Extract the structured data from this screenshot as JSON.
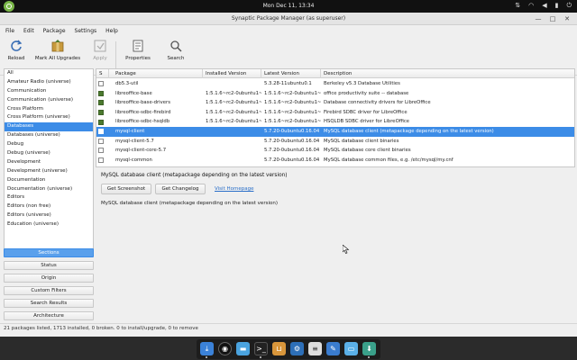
{
  "topbar": {
    "clock": "Mon Dec 11, 13:34",
    "icons": [
      "ubuntu-logo-icon",
      "network-icon",
      "wifi-icon",
      "volume-icon",
      "battery-icon",
      "power-icon"
    ]
  },
  "window": {
    "title": "Synaptic Package Manager  (as superuser)",
    "controls": [
      "minimize",
      "maximize",
      "close"
    ]
  },
  "menubar": [
    "File",
    "Edit",
    "Package",
    "Settings",
    "Help"
  ],
  "toolbar": {
    "reload": "Reload",
    "mark_all": "Mark All Upgrades",
    "apply": "Apply",
    "properties": "Properties",
    "search": "Search"
  },
  "sidebar": {
    "items": [
      "All",
      "Amateur Radio (universe)",
      "Communication",
      "Communication (universe)",
      "Cross Platform",
      "Cross Platform (universe)",
      "Databases",
      "Databases (universe)",
      "Debug",
      "Debug (universe)",
      "Development",
      "Development (universe)",
      "Documentation",
      "Documentation (universe)",
      "Editors",
      "Editors (non free)",
      "Editors (universe)",
      "Education (universe)"
    ],
    "selected_index": 6,
    "buttons": [
      "Sections",
      "Status",
      "Origin",
      "Custom Filters",
      "Search Results",
      "Architecture"
    ]
  },
  "table": {
    "headers": {
      "s": "S",
      "package": "Package",
      "installed": "Installed Version",
      "latest": "Latest Version",
      "description": "Description"
    },
    "rows": [
      {
        "installed_flag": false,
        "package": "db5.3-util",
        "installed": "",
        "latest": "5.3.28-11ubuntu0.1",
        "description": "Berkeley v5.3 Database Utilities"
      },
      {
        "installed_flag": true,
        "package": "libreoffice-base",
        "installed": "1:5.1.6~rc2-0ubuntu1~",
        "latest": "1:5.1.6~rc2-0ubuntu1~",
        "description": "office productivity suite -- database"
      },
      {
        "installed_flag": true,
        "package": "libreoffice-base-drivers",
        "installed": "1:5.1.6~rc2-0ubuntu1~",
        "latest": "1:5.1.6~rc2-0ubuntu1~",
        "description": "Database connectivity drivers for LibreOffice"
      },
      {
        "installed_flag": true,
        "package": "libreoffice-sdbc-firebird",
        "installed": "1:5.1.6~rc2-0ubuntu1~",
        "latest": "1:5.1.6~rc2-0ubuntu1~",
        "description": "Firebird SDBC driver for LibreOffice"
      },
      {
        "installed_flag": true,
        "package": "libreoffice-sdbc-hsqldb",
        "installed": "1:5.1.6~rc2-0ubuntu1~",
        "latest": "1:5.1.6~rc2-0ubuntu1~",
        "description": "HSQLDB SDBC driver for LibreOffice"
      },
      {
        "installed_flag": false,
        "package": "mysql-client",
        "installed": "",
        "latest": "5.7.20-0ubuntu0.16.04",
        "description": "MySQL database client (metapackage depending on the latest version)"
      },
      {
        "installed_flag": false,
        "package": "mysql-client-5.7",
        "installed": "",
        "latest": "5.7.20-0ubuntu0.16.04",
        "description": "MySQL database client binaries"
      },
      {
        "installed_flag": false,
        "package": "mysql-client-core-5.7",
        "installed": "",
        "latest": "5.7.20-0ubuntu0.16.04",
        "description": "MySQL database core client binaries"
      },
      {
        "installed_flag": false,
        "package": "mysql-common",
        "installed": "",
        "latest": "5.7.20-0ubuntu0.16.04",
        "description": "MySQL database common files, e.g. /etc/mysql/my.cnf"
      }
    ],
    "selected_index": 5
  },
  "details": {
    "title": "MySQL database client (metapackage depending on the latest version)",
    "get_screenshot": "Get Screenshot",
    "get_changelog": "Get Changelog",
    "visit_homepage": "Visit Homepage",
    "description": "MySQL database client (metapackage depending on the latest version)"
  },
  "statusbar": "21 packages listed, 1713 installed, 0 broken. 0 to install/upgrade, 0 to remove",
  "dock": {
    "icons": [
      "download-icon",
      "steam-icon",
      "files-folder-icon",
      "terminal-icon",
      "package-box-icon",
      "settings-gear-icon",
      "document-icon",
      "text-editor-icon",
      "screen-icon",
      "synaptic-icon"
    ]
  },
  "colors": {
    "selection": "#3c8ce7",
    "link": "#2a6fc9",
    "installed": "#4c7a2f"
  }
}
